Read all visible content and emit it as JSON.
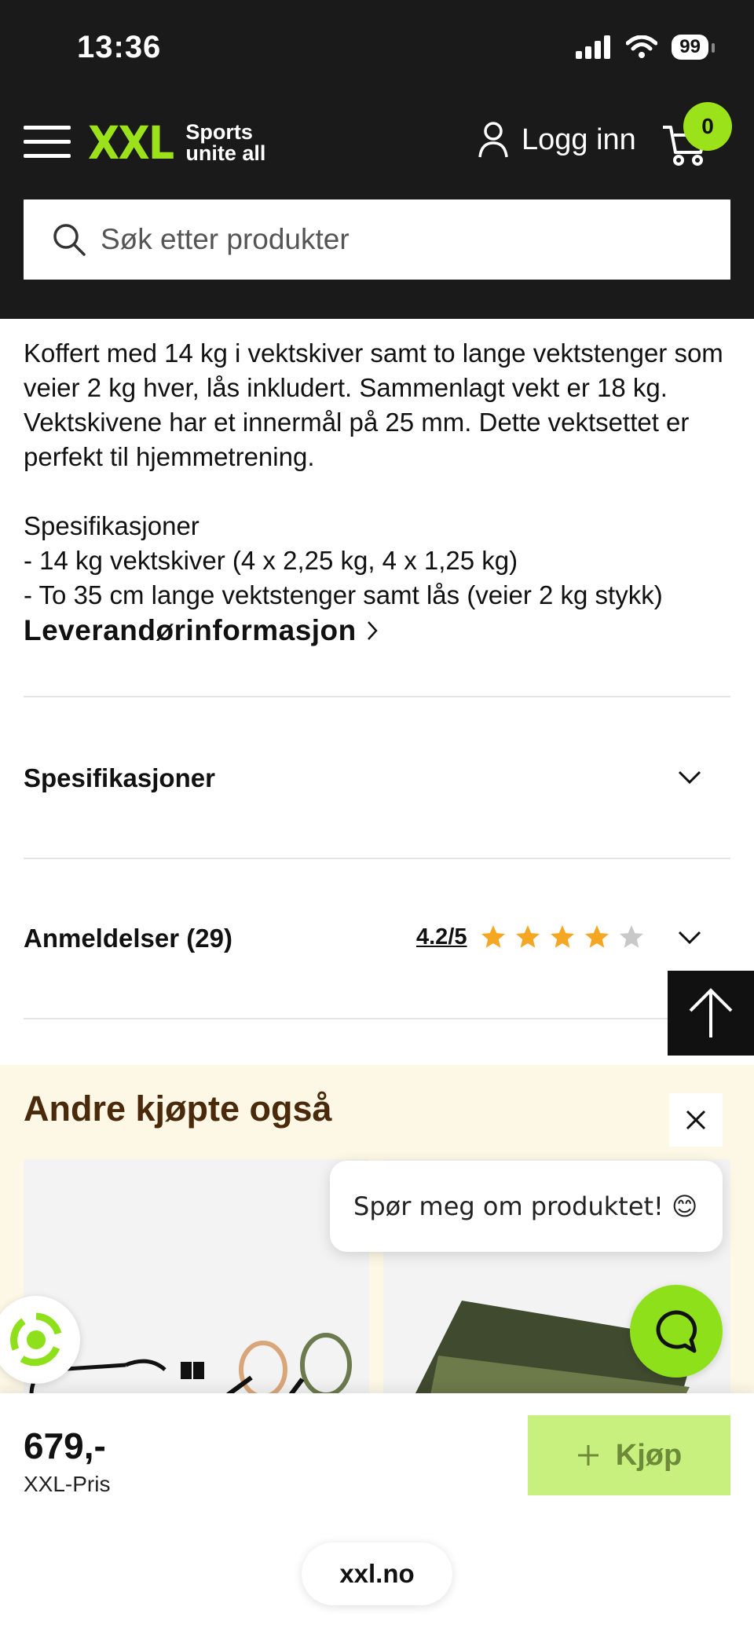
{
  "status_bar": {
    "time": "13:36",
    "battery": "99"
  },
  "header": {
    "logo_main": "XXL",
    "logo_tagline_1": "Sports",
    "logo_tagline_2": "unite all",
    "login_label": "Logg inn",
    "cart_count": "0",
    "search_placeholder": "Søk etter produkter"
  },
  "description": {
    "paragraph": "Koffert med 14 kg i vektskiver samt to lange vektstenger som veier 2 kg hver, lås inkludert. Sammenlagt vekt er 18 kg. Vektskivene har et innermål på 25 mm. Dette vektsettet er perfekt til hjemmetrening.",
    "spec_heading": "Spesifikasjoner",
    "spec_line_1": "- 14 kg vektskiver (4 x 2,25 kg, 4 x 1,25 kg)",
    "spec_line_2": "- To 35 cm lange vektstenger samt lås (veier 2 kg stykk)",
    "supplier_link": "Leverandørinformasjon"
  },
  "accordions": {
    "specifications_label": "Spesifikasjoner",
    "reviews_label": "Anmeldelser (29)",
    "rating_text": "4.2/5",
    "rating_value": 4.2,
    "rating_max": 5
  },
  "recommendations": {
    "title": "Andre kjøpte også"
  },
  "chat": {
    "bubble_text": "Spør meg om produktet! 😊"
  },
  "purchase": {
    "price": "679,-",
    "price_label": "XXL-Pris",
    "buy_label": "Kjøp"
  },
  "browser": {
    "url": "xxl.no"
  },
  "colors": {
    "brand_green": "#9be21a",
    "header_bg": "#1a1a1a",
    "star": "#f5a623"
  }
}
